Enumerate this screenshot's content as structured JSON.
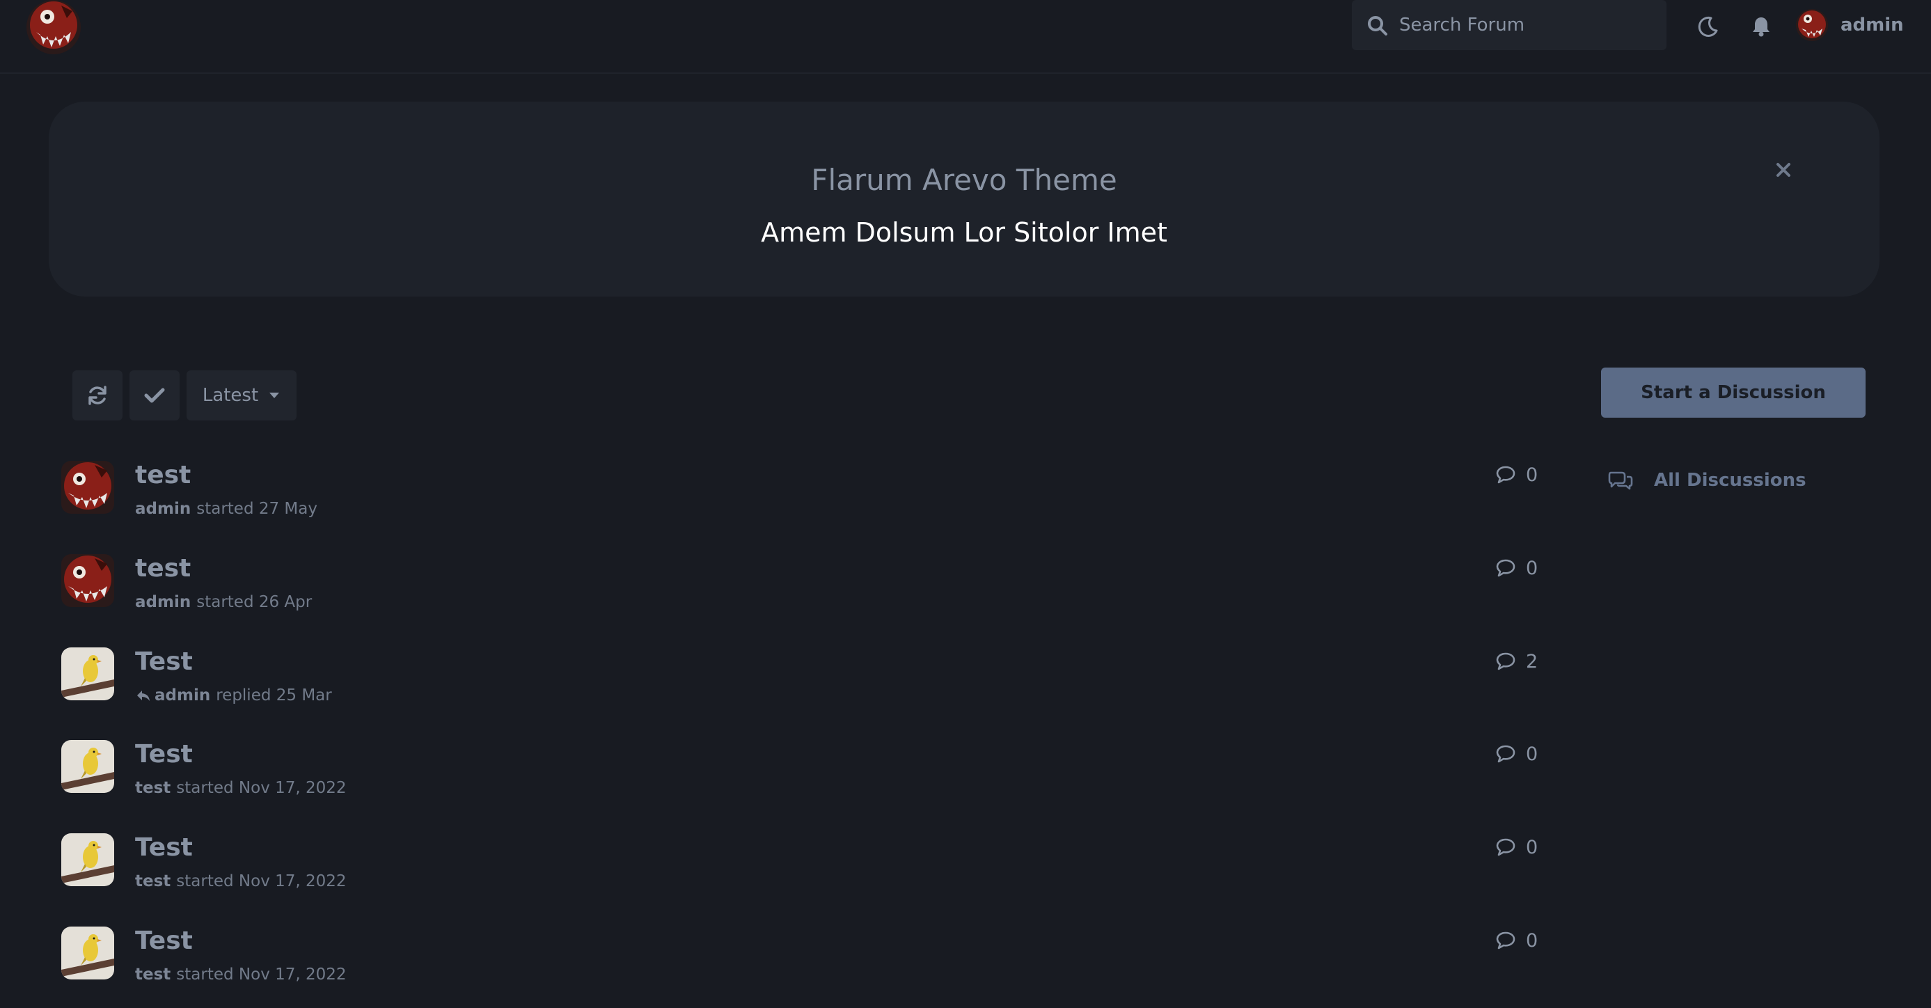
{
  "header": {
    "search_placeholder": "Search Forum",
    "username": "admin"
  },
  "hero": {
    "title": "Flarum Arevo Theme",
    "subtitle": "Amem Dolsum Lor Sitolor Imet"
  },
  "toolbar": {
    "sort_label": "Latest",
    "start_button": "Start a Discussion"
  },
  "sidebar": {
    "nav_label": "All Discussions"
  },
  "discussions": [
    {
      "title": "test",
      "user": "admin",
      "action": "started 27 May",
      "replies": "0",
      "avatar": "monster"
    },
    {
      "title": "test",
      "user": "admin",
      "action": "started 26 Apr",
      "replies": "0",
      "avatar": "monster"
    },
    {
      "title": "Test",
      "user": "admin",
      "action": "replied 25 Mar",
      "replies": "2",
      "avatar": "bird"
    },
    {
      "title": "Test",
      "user": "test",
      "action": "started Nov 17, 2022",
      "replies": "0",
      "avatar": "bird"
    },
    {
      "title": "Test",
      "user": "test",
      "action": "started Nov 17, 2022",
      "replies": "0",
      "avatar": "bird"
    },
    {
      "title": "Test",
      "user": "test",
      "action": "started Nov 17, 2022",
      "replies": "0",
      "avatar": "bird"
    }
  ],
  "colors": {
    "background": "#181b22",
    "hero": "#1e222a",
    "accent_button": "#5b6b87",
    "text": "#8a94a4",
    "nav_link": "#66758f"
  }
}
